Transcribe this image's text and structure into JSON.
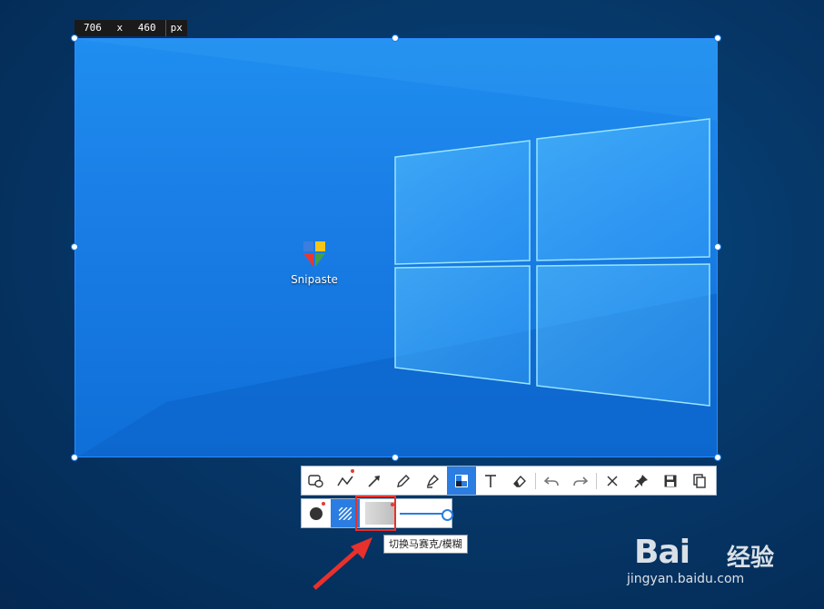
{
  "selection": {
    "size_width": "706",
    "size_x": "x",
    "size_height": "460",
    "unit": "px"
  },
  "desktop": {
    "icon_label": "Snipaste"
  },
  "toolbar": {
    "tools": [
      {
        "name": "rectangle-tool",
        "icon": "rect-ellipse"
      },
      {
        "name": "polyline-tool",
        "icon": "polyline"
      },
      {
        "name": "arrow-tool",
        "icon": "arrow"
      },
      {
        "name": "pencil-tool",
        "icon": "pencil"
      },
      {
        "name": "marker-tool",
        "icon": "marker"
      },
      {
        "name": "mosaic-tool",
        "icon": "mosaic",
        "active": true
      },
      {
        "name": "text-tool",
        "icon": "text"
      },
      {
        "name": "eraser-tool",
        "icon": "eraser"
      },
      {
        "name": "undo-button",
        "icon": "undo"
      },
      {
        "name": "redo-button",
        "icon": "redo"
      },
      {
        "name": "close-button",
        "icon": "close"
      },
      {
        "name": "pin-button",
        "icon": "pin"
      },
      {
        "name": "save-button",
        "icon": "save"
      },
      {
        "name": "copy-button",
        "icon": "copy"
      }
    ]
  },
  "subbar": {
    "slider_value": 1.0
  },
  "tooltip": {
    "text": "切换马赛克/模糊"
  },
  "watermark": {
    "brand": "Bai",
    "brand2": "经验",
    "url": "jingyan.baidu.com"
  },
  "colors": {
    "accent": "#2b7de1",
    "highlight": "#e8302c"
  }
}
